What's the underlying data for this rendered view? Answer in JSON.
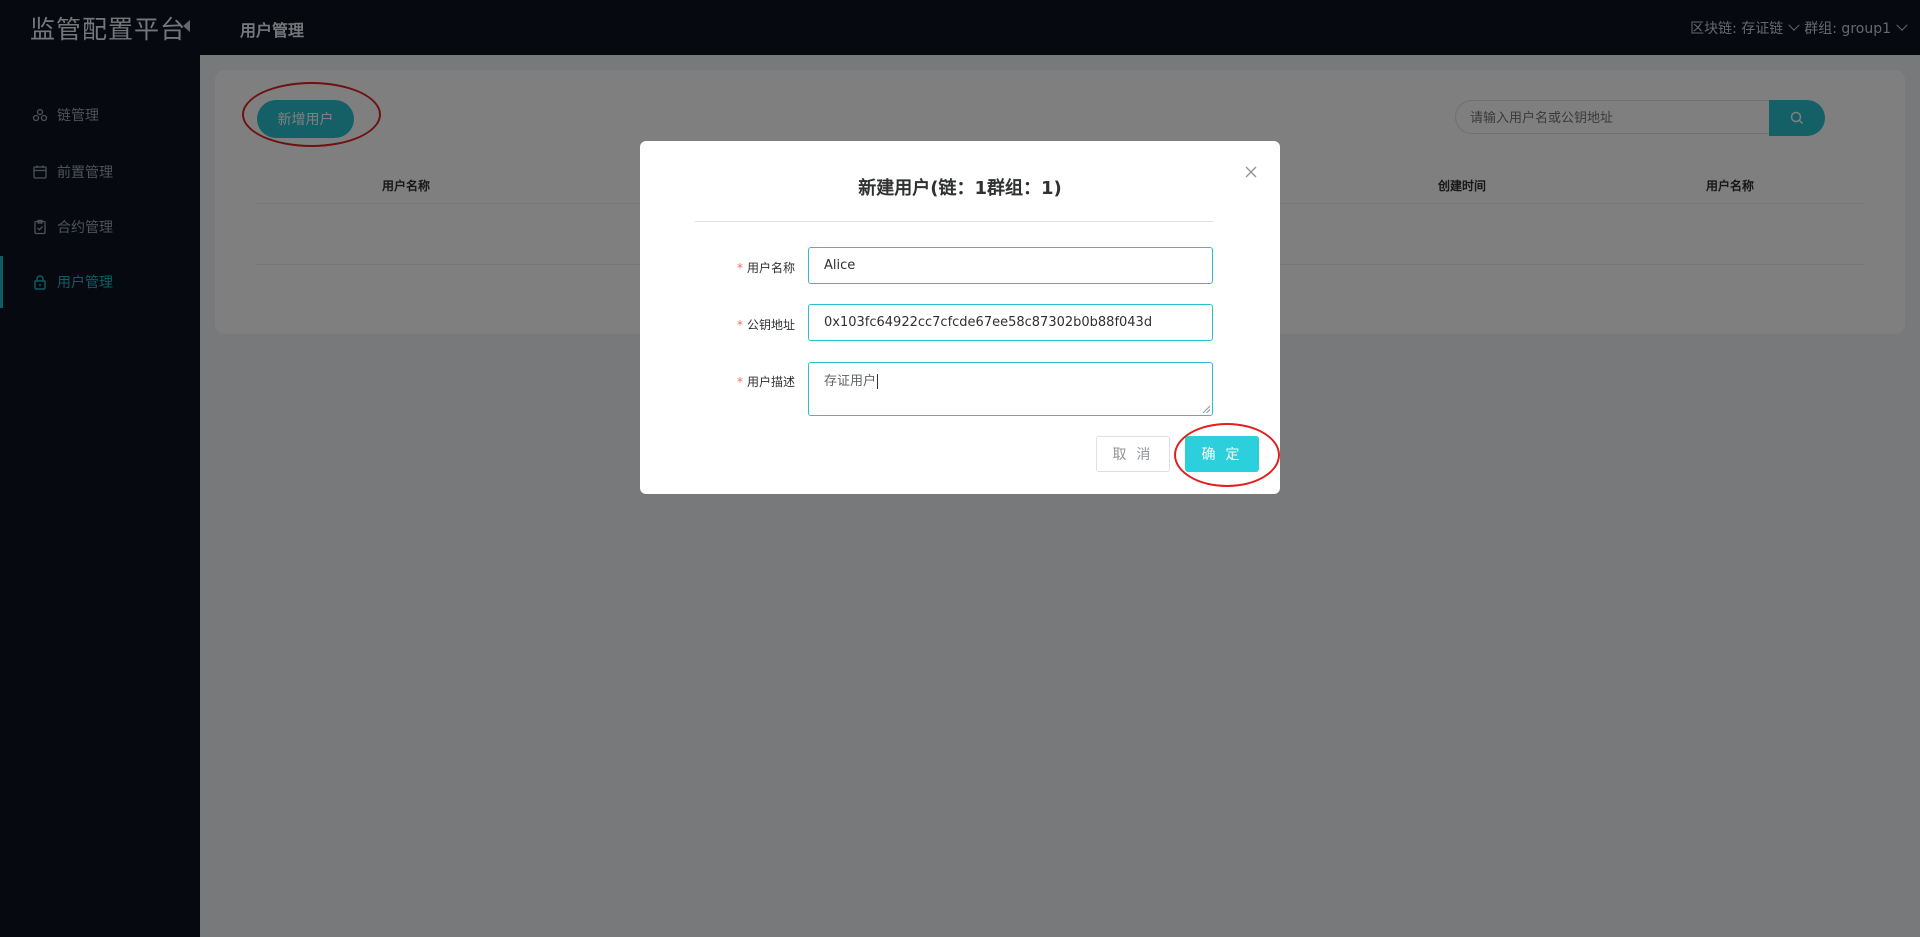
{
  "sidebar": {
    "brand": "监管配置平台",
    "items": [
      {
        "label": "链管理",
        "icon": "chain-icon"
      },
      {
        "label": "前置管理",
        "icon": "calendar-icon"
      },
      {
        "label": "合约管理",
        "icon": "clipboard-icon"
      },
      {
        "label": "用户管理",
        "icon": "lock-icon",
        "active": true
      }
    ]
  },
  "header": {
    "title": "用户管理",
    "chain_selector": "区块链: 存证链",
    "group_selector": "群组: group1"
  },
  "toolbar": {
    "add_user_label": "新增用户",
    "search_placeholder": "请输入用户名或公钥地址"
  },
  "table": {
    "columns": [
      "用户名称",
      "创建时间",
      "用户名称"
    ]
  },
  "modal": {
    "title": "新建用户(链：1群组：1)",
    "fields": [
      {
        "label": "用户名称",
        "value": "Alice"
      },
      {
        "label": "公钥地址",
        "value": "0x103fc64922cc7cfcde67ee58c87302b0b88f043d"
      },
      {
        "label": "用户描述",
        "value": "存证用户"
      }
    ],
    "required_mark": "*",
    "cancel_label": "取 消",
    "ok_label": "确 定"
  },
  "colors": {
    "accent": "#2bc0cf",
    "sidebar_bg": "#0c1220",
    "annotation": "#e02020"
  }
}
